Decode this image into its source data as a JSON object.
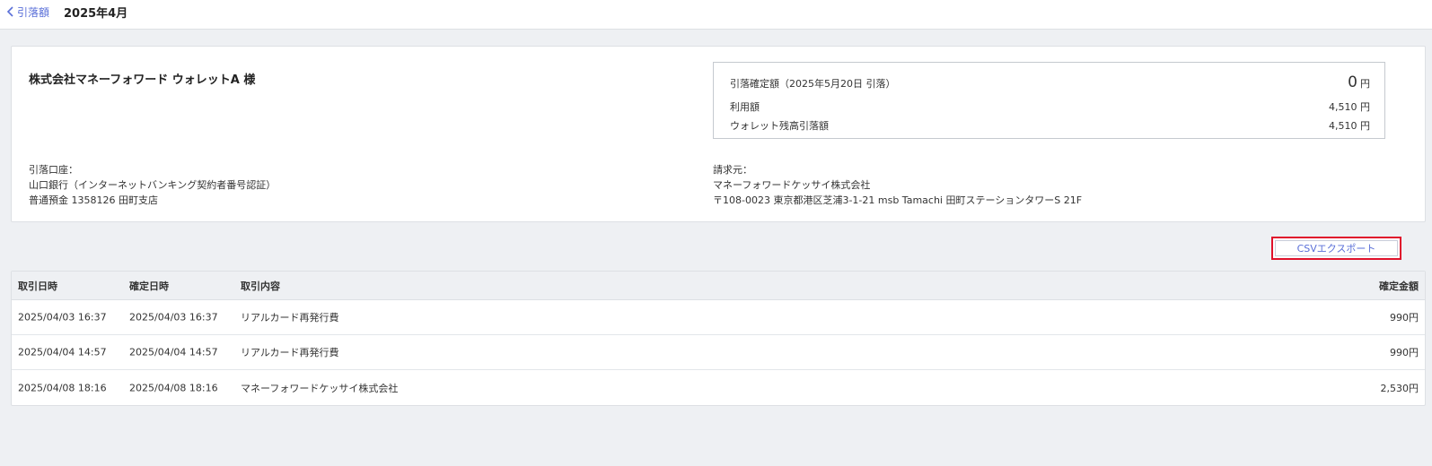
{
  "header": {
    "back_label": "引落額",
    "title": "2025年4月"
  },
  "summary": {
    "merchant_name": "株式会社マネーフォワード ウォレットA 様",
    "confirmed_label": "引落確定額（2025年5月20日 引落）",
    "confirmed_amount": "0",
    "confirmed_unit": "円",
    "usage_label": "利用額",
    "usage_amount": "4,510 円",
    "wallet_label": "ウォレット残高引落額",
    "wallet_amount": "4,510 円"
  },
  "bank": {
    "label": "引落口座：",
    "line1": "山口銀行（インターネットバンキング契約者番号認証）",
    "line2": "普通預金 1358126 田町支店"
  },
  "billing": {
    "label": "請求元：",
    "line1": "マネーフォワードケッサイ株式会社",
    "line2": "〒108-0023 東京都港区芝浦3-1-21 msb Tamachi 田町ステーションタワーS 21F"
  },
  "csv_button": "CSVエクスポート",
  "table": {
    "headers": [
      "取引日時",
      "確定日時",
      "取引内容",
      "確定金額"
    ],
    "rows": [
      [
        "2025/04/03 16:37",
        "2025/04/03 16:37",
        "リアルカード再発行費",
        "990円"
      ],
      [
        "2025/04/04 14:57",
        "2025/04/04 14:57",
        "リアルカード再発行費",
        "990円"
      ],
      [
        "2025/04/08 18:16",
        "2025/04/08 18:16",
        "マネーフォワードケッサイ株式会社",
        "2,530円"
      ]
    ]
  },
  "colors": {
    "link": "#5a6fd8",
    "highlight": "#e0112b",
    "background": "#eef0f3"
  }
}
